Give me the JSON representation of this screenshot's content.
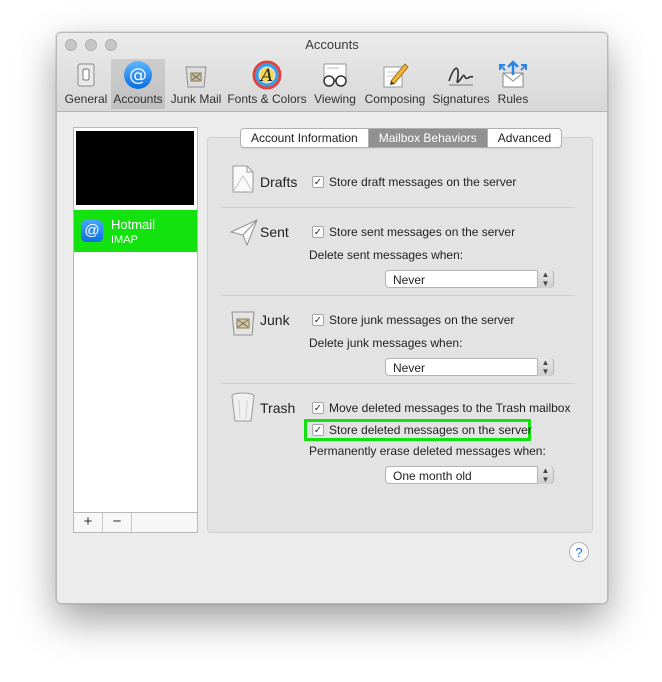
{
  "window": {
    "title": "Accounts"
  },
  "toolbar": {
    "items": [
      {
        "label": "General",
        "icon": "general-switch-icon"
      },
      {
        "label": "Accounts",
        "icon": "at-sign-icon",
        "selected": true
      },
      {
        "label": "Junk Mail",
        "icon": "junk-mail-icon"
      },
      {
        "label": "Fonts & Colors",
        "icon": "fonts-colors-icon"
      },
      {
        "label": "Viewing",
        "icon": "glasses-icon"
      },
      {
        "label": "Composing",
        "icon": "pencil-paper-icon"
      },
      {
        "label": "Signatures",
        "icon": "signature-icon"
      },
      {
        "label": "Rules",
        "icon": "rules-arrows-icon"
      }
    ]
  },
  "accounts": {
    "items": [
      {
        "name": "Hotmail",
        "type": "IMAP",
        "icon": "at-sign-icon",
        "selected": true
      }
    ],
    "add_label": "+",
    "remove_label": "−"
  },
  "tabs": {
    "items": [
      {
        "label": "Account Information",
        "selected": false
      },
      {
        "label": "Mailbox Behaviors",
        "selected": true
      },
      {
        "label": "Advanced",
        "selected": false
      }
    ]
  },
  "sections": {
    "drafts": {
      "title": "Drafts",
      "store_label": "Store draft messages on the server",
      "store_checked": true
    },
    "sent": {
      "title": "Sent",
      "store_label": "Store sent messages on the server",
      "store_checked": true,
      "delete_label": "Delete sent messages when:",
      "delete_value": "Never"
    },
    "junk": {
      "title": "Junk",
      "store_label": "Store junk messages on the server",
      "store_checked": true,
      "delete_label": "Delete junk messages when:",
      "delete_value": "Never"
    },
    "trash": {
      "title": "Trash",
      "move_label": "Move deleted messages to the Trash mailbox",
      "move_checked": true,
      "store_label": "Store deleted messages on the server",
      "store_checked": true,
      "erase_label": "Permanently erase deleted messages when:",
      "erase_value": "One month old"
    }
  },
  "help": {
    "label": "?"
  },
  "colors": {
    "highlight": "#12e30f",
    "accent": "#1d6fe0",
    "selected_tab": "#909090"
  }
}
